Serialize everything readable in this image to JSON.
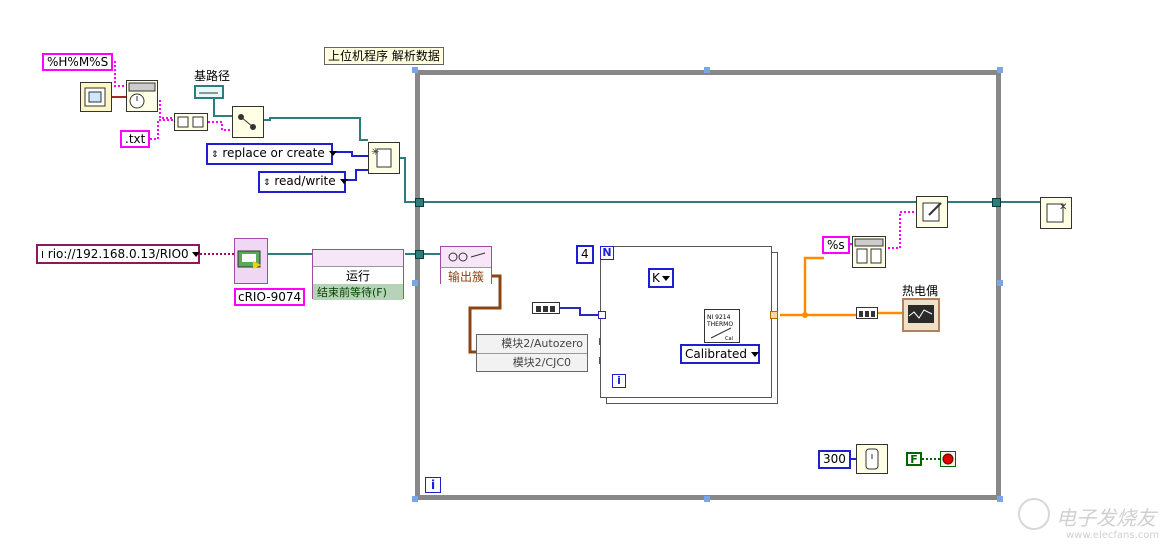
{
  "title": "上位机程序 解析数据",
  "format_constant": "%H%M%S",
  "txt_constant": ".txt",
  "base_path_label": "基路径",
  "open_mode": "replace or create",
  "access_mode": "read/write",
  "rio_address": "rio://192.168.0.13/RIO0",
  "crio_label": "cRIO-9074",
  "run_label": "运行",
  "wait_label": "结束前等待(F)",
  "output_fifo_label": "输出簇",
  "channels": [
    "模块2/Autozero",
    "模块2/CJC0"
  ],
  "loop_count": "4",
  "loop_count_terminal": "N",
  "iteration_terminal": "i",
  "thermo_type": "K",
  "thermo_mode": "Calibrated",
  "format_s": "%s",
  "thermocouple_label": "热电偶",
  "wait_ms": "300",
  "stop_bool": "F",
  "watermark": "电子发烧友",
  "watermark_url": "www.elecfans.com",
  "thermo_vi_text": "NI 9214\nTHERMO"
}
